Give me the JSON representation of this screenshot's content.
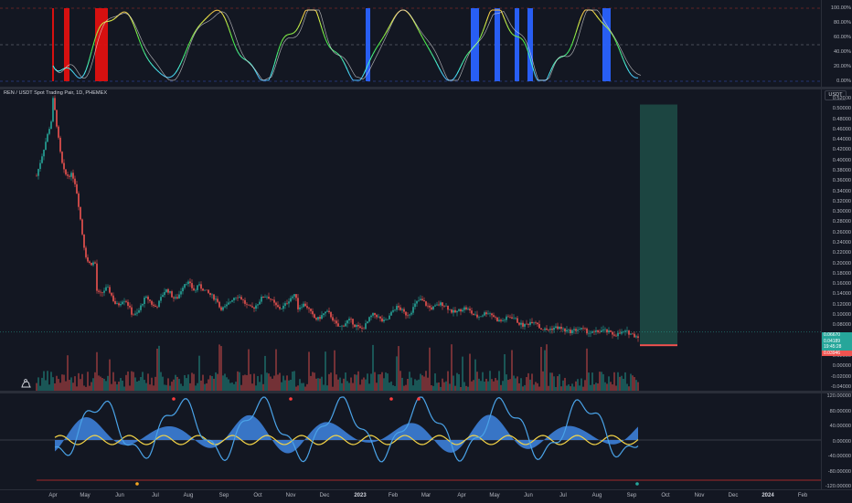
{
  "symbol": {
    "description": "REN / USDT Spot Trading Pair, 1D, PHEMEX",
    "currency": "USDT"
  },
  "colors": {
    "background": "#131722",
    "up": "#26a69a",
    "down": "#ef5350",
    "oscillator_blue": "#2962ff",
    "oscillator_red": "#e01010",
    "macd_area": "#3d7fd8",
    "wave_line": "#4aa3e8",
    "signal_yellow": "#f5d547",
    "target_zone": "#1e4d47",
    "stop_line": "#ef5350",
    "logo_icon": "tradingview-icon"
  },
  "stoch_pane": {
    "ticks": [
      "100.00%",
      "80.00%",
      "60.00%",
      "40.00%",
      "20.00%",
      "0.00%"
    ]
  },
  "price_pane": {
    "ticks": [
      "0.52000",
      "0.50000",
      "0.48000",
      "0.46000",
      "0.44000",
      "0.42000",
      "0.40000",
      "0.38000",
      "0.36000",
      "0.34000",
      "0.32000",
      "0.30000",
      "0.28000",
      "0.26000",
      "0.24000",
      "0.22000",
      "0.20000",
      "0.18000",
      "0.16000",
      "0.14000",
      "0.12000",
      "0.10000",
      "0.08000",
      "0.06000",
      "0.04000",
      "0.02000",
      "0.00000",
      "-0.02000",
      "-0.04000"
    ],
    "price_tags": [
      "0.06670",
      "0.04189",
      "19:45:28",
      "0.03946"
    ],
    "price_tag_colors": [
      "#26a69a",
      "#26a69a",
      "#26a69a",
      "#ef5350"
    ]
  },
  "osc_pane": {
    "ticks": [
      "120.00000",
      "80.00000",
      "40.00000",
      "0.00000",
      "-40.00000",
      "-80.00000",
      "-120.00000"
    ]
  },
  "time_axis": {
    "labels": [
      "Apr",
      "May",
      "Jun",
      "Jul",
      "Aug",
      "Sep",
      "Oct",
      "Nov",
      "Dec",
      "2023",
      "Feb",
      "Mar",
      "Apr",
      "May",
      "Jun",
      "Jul",
      "Aug",
      "Sep",
      "Oct",
      "Nov",
      "Dec",
      "2024",
      "Feb"
    ],
    "bold": [
      "2023",
      "2024"
    ]
  }
}
